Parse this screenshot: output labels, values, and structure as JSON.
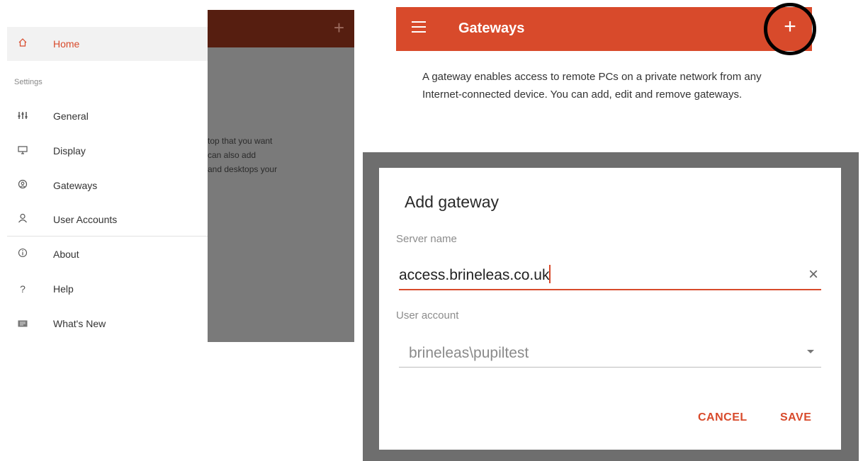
{
  "nav_panel": {
    "background_lines": [
      "top that you want",
      "can also add",
      "and desktops your"
    ],
    "home_label": "Home",
    "section_label": "Settings",
    "items": [
      {
        "label": "General",
        "icon": "sliders-icon"
      },
      {
        "label": "Display",
        "icon": "monitor-icon"
      },
      {
        "label": "Gateways",
        "icon": "gateway-icon"
      },
      {
        "label": "User Accounts",
        "icon": "user-icon"
      },
      {
        "label": "About",
        "icon": "info-icon"
      },
      {
        "label": "Help",
        "icon": "help-icon"
      },
      {
        "label": "What's New",
        "icon": "whats-new-icon"
      }
    ]
  },
  "gateways_page": {
    "title": "Gateways",
    "add_glyph": "+",
    "description": "A gateway enables access to remote PCs on a private network from any Internet-connected device. You can add, edit and remove gateways."
  },
  "dialog": {
    "title": "Add gateway",
    "server_label": "Server name",
    "server_value": "access.brineleas.co.uk",
    "account_label": "User account",
    "account_value": "brineleas\\pupiltest",
    "cancel": "CANCEL",
    "save": "SAVE"
  },
  "colors": {
    "accent": "#d84a2b",
    "app_bar_dimmed": "#561e10",
    "scrim": "#7a7a7a"
  }
}
